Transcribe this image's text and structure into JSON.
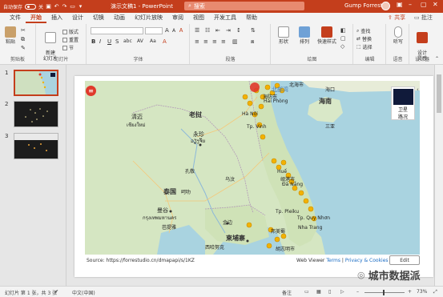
{
  "titlebar": {
    "autosave_label": "自动保存",
    "autosave_state": "关",
    "doc_title": "演示文稿1 - PowerPoint",
    "search_placeholder": "搜索",
    "user_name": "Gump Forrest",
    "brand_color": "#c43e1c"
  },
  "menu": {
    "tabs": [
      "文件",
      "开始",
      "插入",
      "设计",
      "切换",
      "动画",
      "幻灯片放映",
      "审阅",
      "视图",
      "开发工具",
      "帮助"
    ],
    "active_tab": "开始",
    "share_label": "共享",
    "comment_label": "批注"
  },
  "ribbon": {
    "clipboard": {
      "label": "剪贴板",
      "paste": "粘贴"
    },
    "slides": {
      "label": "幻灯片",
      "new_slide": "新建\n幻灯片",
      "layout": "版式",
      "reset": "重置",
      "section": "节"
    },
    "font": {
      "label": "字体",
      "bold": "B",
      "italic": "I",
      "underline": "U",
      "strike": "S",
      "shadow": "abc",
      "spacing": "AV",
      "case": "Aa"
    },
    "paragraph": {
      "label": "段落"
    },
    "drawing": {
      "label": "绘图",
      "shapes": "形状",
      "arrange": "排列",
      "quick_styles": "快速样式"
    },
    "editing": {
      "label": "编辑",
      "find": "查找",
      "replace": "替换",
      "select": "选择"
    },
    "voice": {
      "label": "语音",
      "dictate": "听写"
    },
    "designer": {
      "label": "设计器",
      "design_ideas": "设计\n灵感"
    }
  },
  "thumbnails": [
    {
      "number": "1",
      "active": true
    },
    {
      "number": "2",
      "active": false
    },
    {
      "number": "3",
      "active": false
    }
  ],
  "map": {
    "labels": {
      "laos": "老挝",
      "thailand": "泰国",
      "cambodia": "柬埔寨",
      "hainan": "海南",
      "beibu_gulf": "北部湾",
      "haiphong": "Hải Phòng",
      "haiphong_cn": "海防市",
      "hanoi": "Hà Nội",
      "vinh": "Tp. Vinh",
      "vientiane": "永珍",
      "vientiane_local": "ວຽງຈັນ",
      "qinghe": "清迈",
      "chiang_mai": "เชียงใหม่",
      "bangkok": "曼谷",
      "bangkok_local": "กรุงเทพมหานคร",
      "hue": "Huế",
      "danang": "岘港市",
      "danang_local": "Đà Nẵng",
      "phnom_penh": "金边",
      "sihanoukville": "西哈努克",
      "ho_chi_minh": "胡志明市",
      "nha_trang": "Nha Trang",
      "pleiku": "Tp. Pleiku",
      "quy_nhon": "Tp. Quy Nhơn",
      "buon_ma_thuot": "邦美蜀",
      "korat": "呵叻",
      "khon_kaen": "孔敬",
      "ubon": "乌汶",
      "pattaya": "芭提雅",
      "haikou": "海口",
      "sanya": "三亚",
      "beihai": "北海市"
    },
    "layer": {
      "satellite": "卫星",
      "traffic": "路况"
    },
    "source_text": "Source: https://forrestudio.cn/dmapapi/s/1KZ",
    "viewer_prefix": "Web Viewer",
    "terms_link": "Terms",
    "privacy_link": "Privacy & Cookies",
    "edit_button": "Edit"
  },
  "statusbar": {
    "slide_info": "幻灯片 第 1 张，共 3 张",
    "language": "中文(中国)",
    "notes": "备注",
    "zoom": "73%"
  },
  "watermark": {
    "text": "城市数据派"
  }
}
